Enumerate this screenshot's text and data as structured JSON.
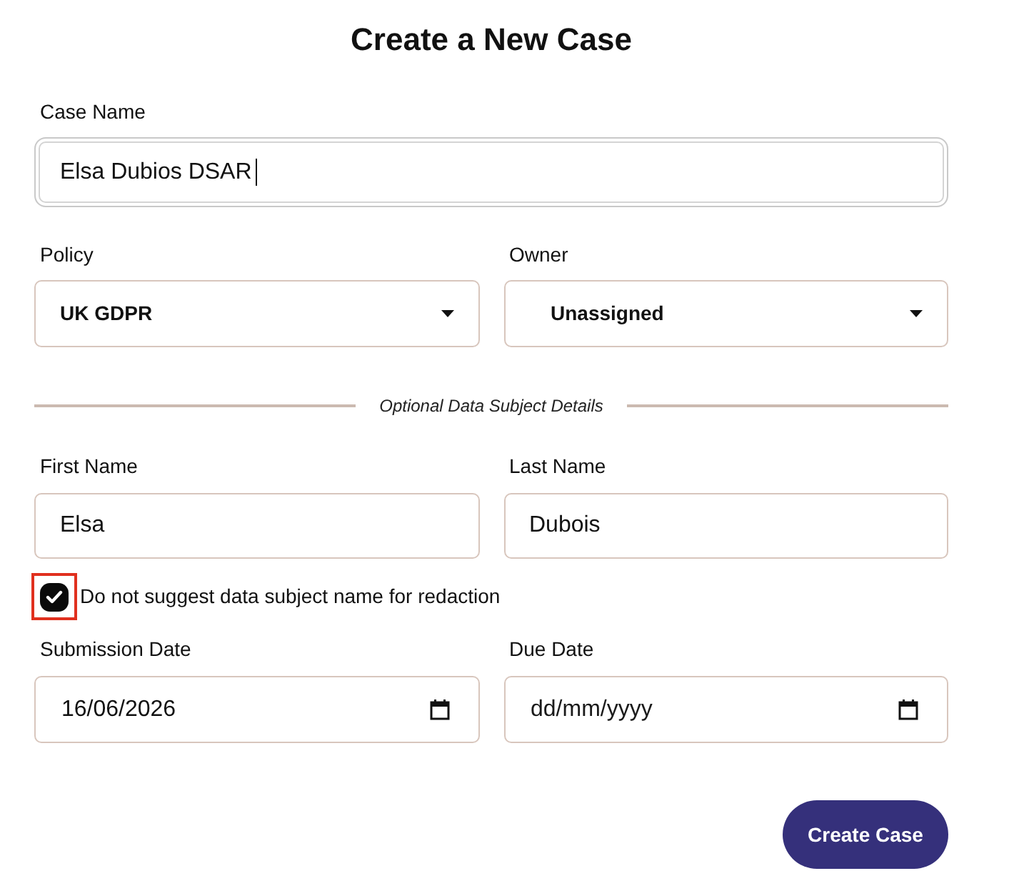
{
  "title": "Create a New Case",
  "case_name": {
    "label": "Case Name",
    "value": "Elsa Dubios DSAR",
    "focused": true
  },
  "selects": [
    {
      "label": "Policy",
      "value": "UK GDPR"
    },
    {
      "label": "Owner",
      "value": "Unassigned"
    }
  ],
  "section_divider": {
    "label": "Optional Data Subject Details"
  },
  "name_fields": [
    {
      "label": "First Name",
      "value": "Elsa"
    },
    {
      "label": "Last Name",
      "value": "Dubois"
    }
  ],
  "redaction_option": {
    "label": "Do not suggest data subject name for redaction",
    "checked": true,
    "highlighted": true
  },
  "date_fields": [
    {
      "label": "Submission Date",
      "value": "16/06/2026"
    },
    {
      "label": "Due Date",
      "placeholder": "dd/mm/yyyy"
    }
  ],
  "submit_button": {
    "label": "Create Case"
  }
}
